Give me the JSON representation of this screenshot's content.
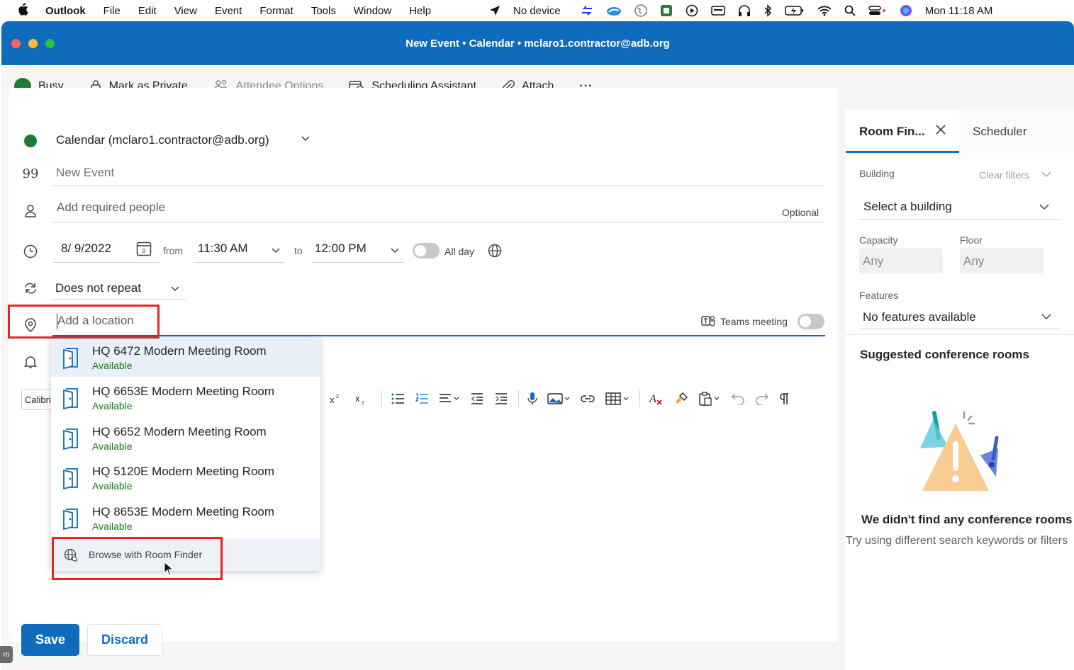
{
  "menubar": {
    "app": "Outlook",
    "items": [
      "File",
      "Edit",
      "View",
      "Event",
      "Format",
      "Tools",
      "Window",
      "Help"
    ],
    "device": "No device",
    "clock": "Mon  11:18 AM"
  },
  "window": {
    "title": "New Event • Calendar • mclaro1.contractor@adb.org"
  },
  "toolbar": {
    "busy": "Busy",
    "private": "Mark as Private",
    "attendee": "Attendee Options",
    "scheduling": "Scheduling Assistant",
    "attach": "Attach",
    "more": "···"
  },
  "form": {
    "calendar": "Calendar (mclaro1.contractor@adb.org)",
    "title_placeholder": "New Event",
    "people_placeholder": "Add required people",
    "optional": "Optional",
    "date": "8/ 9/2022",
    "from_label": "from",
    "start_time": "11:30 AM",
    "to_label": "to",
    "end_time": "12:00 PM",
    "all_day": "All day",
    "repeat": "Does not repeat",
    "location_placeholder": "Add a location",
    "teams": "Teams meeting",
    "font": "Calibri"
  },
  "rooms": [
    {
      "name": "HQ 6472 Modern Meeting Room",
      "status": "Available"
    },
    {
      "name": "HQ 6653E Modern Meeting Room",
      "status": "Available"
    },
    {
      "name": "HQ 6652 Modern Meeting Room",
      "status": "Available"
    },
    {
      "name": "HQ 5120E Modern Meeting Room",
      "status": "Available"
    },
    {
      "name": "HQ 8653E Modern Meeting Room",
      "status": "Available"
    }
  ],
  "browse": "Browse with Room Finder",
  "actions": {
    "save": "Save",
    "discard": "Discard"
  },
  "side": {
    "tab_room_finder": "Room Fin...",
    "tab_scheduler": "Scheduler",
    "building_label": "Building",
    "clear_filters": "Clear filters",
    "building_value": "Select a building",
    "capacity_label": "Capacity",
    "capacity_value": "Any",
    "floor_label": "Floor",
    "floor_value": "Any",
    "features_label": "Features",
    "features_value": "No features available",
    "suggested": "Suggested conference rooms",
    "empty_title": "We didn't find any conference rooms",
    "empty_hint": "Try using different search keywords or filters"
  },
  "corner_tag": "ro",
  "colors": {
    "brand": "#0f6cbd",
    "busy": "#1e7b34",
    "available": "#107c10",
    "highlight": "#e8261c"
  }
}
